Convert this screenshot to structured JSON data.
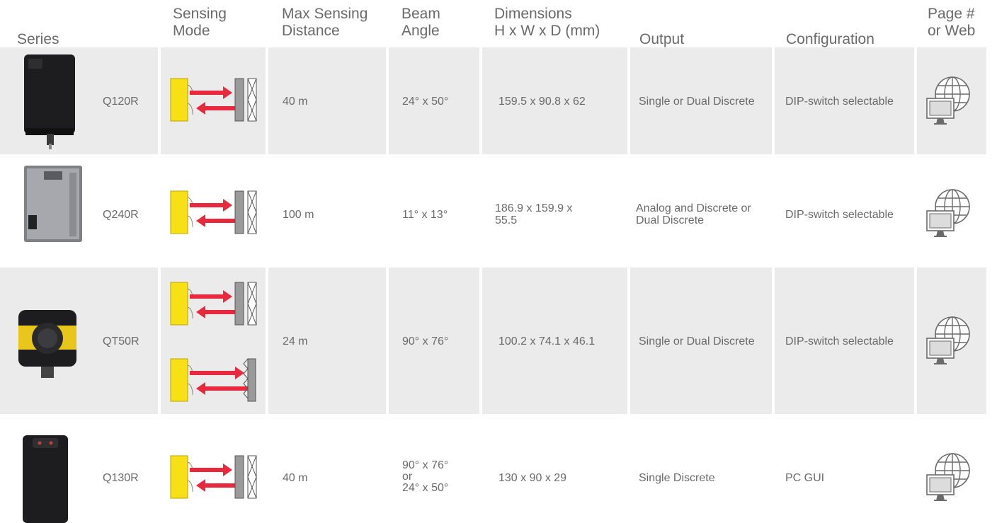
{
  "headers": {
    "series": "Series",
    "sensing_mode": [
      "Sensing",
      "Mode"
    ],
    "max_distance": [
      "Max Sensing",
      "Distance"
    ],
    "beam_angle": [
      "Beam",
      "Angle"
    ],
    "dimensions": [
      "Dimensions",
      "H x W x D (mm)"
    ],
    "output": "Output",
    "configuration": "Configuration",
    "page_web": [
      "Page #",
      "or Web"
    ]
  },
  "rows": [
    {
      "series": "Q120R",
      "distance": "40 m",
      "beam_angle": [
        "24° x 50°"
      ],
      "dimensions": [
        "159.5 x 90.8 x 62"
      ],
      "output": [
        "Single or Dual Discrete"
      ],
      "configuration": "DIP-switch selectable",
      "link_icon": "web-monitor-icon"
    },
    {
      "series": "Q240R",
      "distance": "100 m",
      "beam_angle": [
        "11° x 13°"
      ],
      "dimensions": [
        "186.9 x 159.9 x",
        "55.5"
      ],
      "output": [
        "Analog and Discrete or",
        "Dual Discrete"
      ],
      "configuration": "DIP-switch selectable",
      "link_icon": "web-monitor-icon"
    },
    {
      "series": "QT50R",
      "distance": "24 m",
      "beam_angle": [
        "90° x 76°"
      ],
      "dimensions": [
        "100.2 x 74.1 x 46.1"
      ],
      "output": [
        "Single or Dual Discrete"
      ],
      "configuration": "DIP-switch selectable",
      "link_icon": "web-monitor-icon"
    },
    {
      "series": "Q130R",
      "distance": "40 m",
      "beam_angle": [
        "90° x 76°",
        "or",
        "24° x 50°"
      ],
      "dimensions": [
        "130 x 90 x 29"
      ],
      "output": [
        "Single Discrete"
      ],
      "configuration": "PC GUI",
      "link_icon": "web-monitor-icon"
    }
  ],
  "colors": {
    "row_bg": "#ebebeb",
    "sensor_yellow": "#f7e015",
    "beam_red": "#e8283c",
    "target_grey": "#9a9a9a"
  }
}
